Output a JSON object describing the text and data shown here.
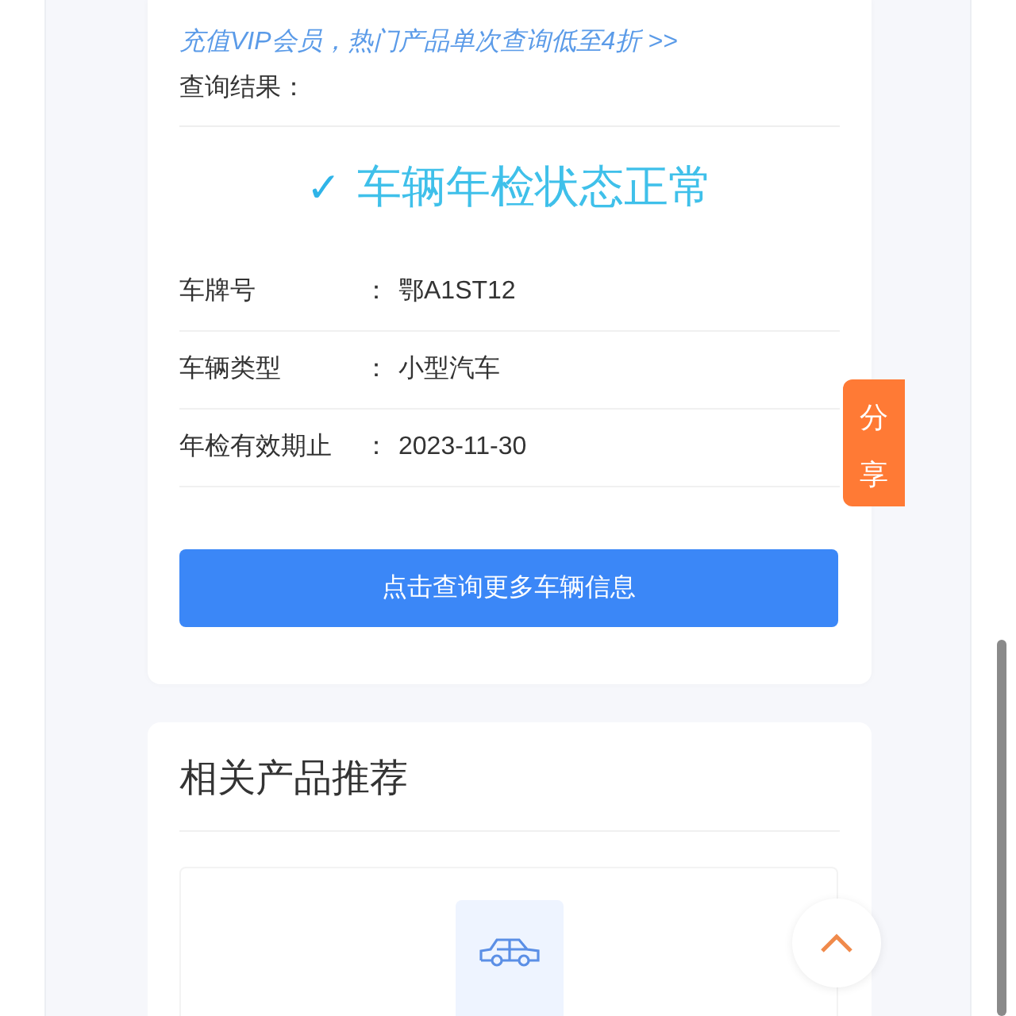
{
  "promo_link": "充值VIP会员，热门产品单次查询低至4折 >>",
  "result_label": "查询结果：",
  "status": {
    "mark": "✓",
    "text": "车辆年检状态正常"
  },
  "fields": [
    {
      "label": "车牌号",
      "colon": "：",
      "value": "鄂A1ST12"
    },
    {
      "label": "车辆类型",
      "colon": "：",
      "value": "小型汽车"
    },
    {
      "label": "年检有效期止",
      "colon": "：",
      "value": "2023-11-30"
    }
  ],
  "more_button": "点击查询更多车辆信息",
  "share_tab": "分享",
  "recommend": {
    "title": "相关产品推荐"
  }
}
